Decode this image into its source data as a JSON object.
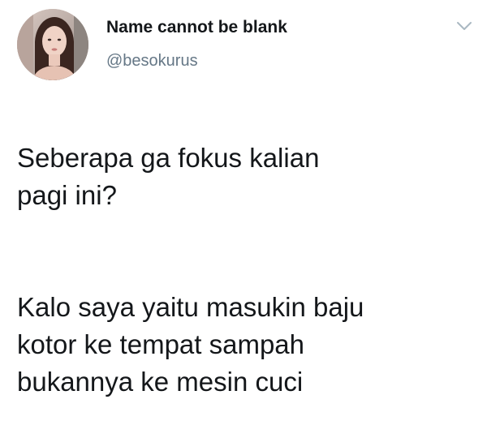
{
  "user": {
    "display_name": "Name cannot be blank",
    "handle": "@besokurus",
    "avatar": "profile-photo-woman"
  },
  "menu": {
    "icon": "chevron-down-icon"
  },
  "tweet": {
    "paragraphs": [
      "Seberapa ga fokus kalian\npagi ini?",
      "Kalo saya yaitu masukin baju\nkotor ke tempat sampah\nbukannya ke mesin cuci"
    ]
  },
  "colors": {
    "text": "#14171a",
    "handle": "#657786",
    "chevron": "#aab8c2",
    "background": "#ffffff"
  }
}
